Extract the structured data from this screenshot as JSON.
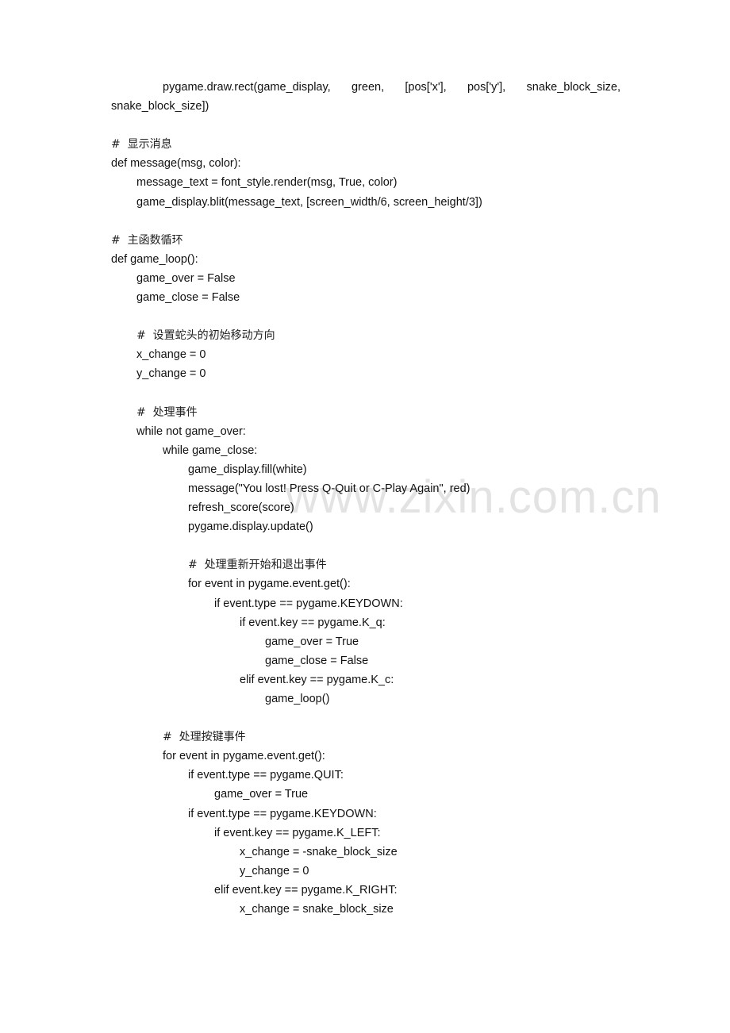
{
  "document": {
    "watermark": "www.zixin.com.cn",
    "first_line_parts": [
      "pygame.draw.rect(game_display,",
      "green,",
      "[pos['x'],",
      "pos['y'],",
      "snake_block_size,"
    ],
    "lines": [
      {
        "indent": 0,
        "text": "snake_block_size])"
      },
      {
        "indent": 0,
        "text": ""
      },
      {
        "indent": 0,
        "text": "#  显示消息",
        "comment": true
      },
      {
        "indent": 0,
        "text": "def message(msg, color):"
      },
      {
        "indent": 1,
        "text": "message_text = font_style.render(msg, True, color)"
      },
      {
        "indent": 1,
        "text": "game_display.blit(message_text, [screen_width/6, screen_height/3])"
      },
      {
        "indent": 0,
        "text": ""
      },
      {
        "indent": 0,
        "text": "#  主函数循环",
        "comment": true
      },
      {
        "indent": 0,
        "text": "def game_loop():"
      },
      {
        "indent": 1,
        "text": "game_over = False"
      },
      {
        "indent": 1,
        "text": "game_close = False"
      },
      {
        "indent": 0,
        "text": ""
      },
      {
        "indent": 1,
        "text": "#  设置蛇头的初始移动方向",
        "comment": true
      },
      {
        "indent": 1,
        "text": "x_change = 0"
      },
      {
        "indent": 1,
        "text": "y_change = 0"
      },
      {
        "indent": 0,
        "text": ""
      },
      {
        "indent": 1,
        "text": "#  处理事件",
        "comment": true
      },
      {
        "indent": 1,
        "text": "while not game_over:"
      },
      {
        "indent": 2,
        "text": "while game_close:"
      },
      {
        "indent": 3,
        "text": "game_display.fill(white)"
      },
      {
        "indent": 3,
        "text": "message(\"You lost! Press Q-Quit or C-Play Again\", red)"
      },
      {
        "indent": 3,
        "text": "refresh_score(score)"
      },
      {
        "indent": 3,
        "text": "pygame.display.update()"
      },
      {
        "indent": 0,
        "text": ""
      },
      {
        "indent": 3,
        "text": "#  处理重新开始和退出事件",
        "comment": true
      },
      {
        "indent": 3,
        "text": "for event in pygame.event.get():"
      },
      {
        "indent": 4,
        "text": "if event.type == pygame.KEYDOWN:"
      },
      {
        "indent": 5,
        "text": "if event.key == pygame.K_q:"
      },
      {
        "indent": 6,
        "text": "game_over = True"
      },
      {
        "indent": 6,
        "text": "game_close = False"
      },
      {
        "indent": 5,
        "text": "elif event.key == pygame.K_c:"
      },
      {
        "indent": 6,
        "text": "game_loop()"
      },
      {
        "indent": 0,
        "text": ""
      },
      {
        "indent": 2,
        "text": "#  处理按键事件",
        "comment": true
      },
      {
        "indent": 2,
        "text": "for event in pygame.event.get():"
      },
      {
        "indent": 3,
        "text": "if event.type == pygame.QUIT:"
      },
      {
        "indent": 4,
        "text": "game_over = True"
      },
      {
        "indent": 3,
        "text": "if event.type == pygame.KEYDOWN:"
      },
      {
        "indent": 4,
        "text": "if event.key == pygame.K_LEFT:"
      },
      {
        "indent": 5,
        "text": "x_change = -snake_block_size"
      },
      {
        "indent": 5,
        "text": "y_change = 0"
      },
      {
        "indent": 4,
        "text": "elif event.key == pygame.K_RIGHT:"
      },
      {
        "indent": 5,
        "text": "x_change = snake_block_size"
      }
    ]
  }
}
